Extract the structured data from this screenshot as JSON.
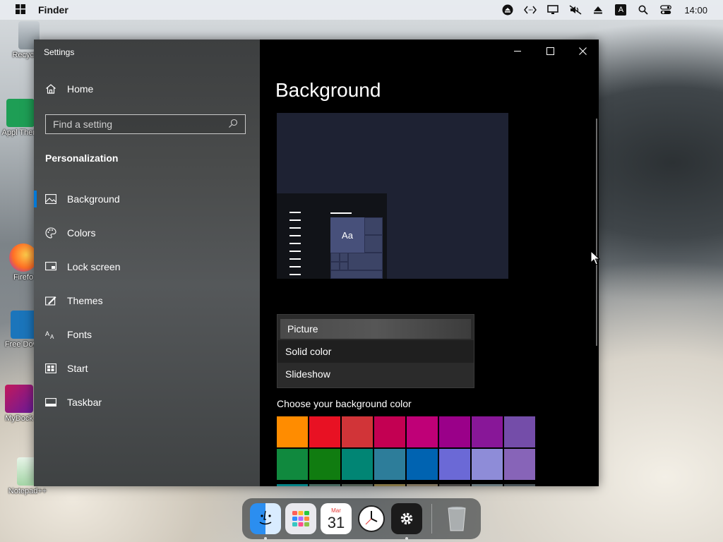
{
  "menubar": {
    "app_name": "Finder",
    "clock": "14:00",
    "icons": [
      "upload-icon",
      "code-icon",
      "display-icon",
      "mute-icon",
      "eject-icon",
      "keyboard-a-icon",
      "search-icon",
      "control-center-icon"
    ],
    "keyboard_letter": "A"
  },
  "desktop": {
    "icons": [
      {
        "label": "Recycle"
      },
      {
        "label": "Appl Them"
      },
      {
        "label": "Firefo"
      },
      {
        "label": "Free Downl"
      },
      {
        "label": "MyDock"
      },
      {
        "label": "Notepad++"
      }
    ]
  },
  "window": {
    "title": "Settings",
    "home_label": "Home",
    "search_placeholder": "Find a setting",
    "section_label": "Personalization",
    "nav": [
      {
        "label": "Background",
        "icon": "image-icon"
      },
      {
        "label": "Colors",
        "icon": "palette-icon"
      },
      {
        "label": "Lock screen",
        "icon": "lock-screen-icon"
      },
      {
        "label": "Themes",
        "icon": "themes-icon"
      },
      {
        "label": "Fonts",
        "icon": "fonts-icon"
      },
      {
        "label": "Start",
        "icon": "start-icon"
      },
      {
        "label": "Taskbar",
        "icon": "taskbar-icon"
      }
    ]
  },
  "main": {
    "title": "Background",
    "preview_tile_text": "Aa",
    "dropdown_options": [
      "Picture",
      "Solid color",
      "Slideshow"
    ],
    "choose_label": "Choose your background color",
    "swatch_colors": [
      "#ff8c00",
      "#e81123",
      "#d13438",
      "#c30052",
      "#bf0077",
      "#9a0089",
      "#881798",
      "#744da9",
      "#10893e",
      "#107c10",
      "#018574",
      "#2d7d9a",
      "#0063b1",
      "#6b69d6",
      "#8e8cd8",
      "#8764b8"
    ],
    "partial_row_colors": [
      "#038387",
      "#486860",
      "#525e54",
      "#847545",
      "#7e735f",
      "#4c4a48",
      "#69797e",
      "#4a5459"
    ]
  },
  "dock": {
    "calendar_month": "Mar",
    "calendar_day": "31"
  }
}
